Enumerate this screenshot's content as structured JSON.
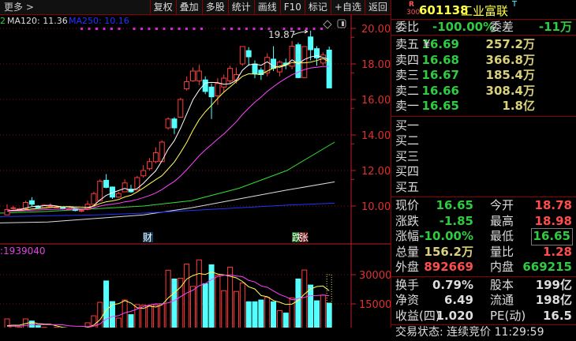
{
  "toolbar": {
    "more": "更多 >",
    "buttons": [
      "复权",
      "叠加",
      "多股",
      "统计",
      "画线",
      "F10",
      "标记",
      "+自选",
      "返回"
    ]
  },
  "chart_header": {
    "fragment": "2",
    "ma120": "MA120: 11.36",
    "ma250": "MA250: 10.16",
    "high_label": "19.87",
    "volume_label": ":1939040",
    "marker_fin": "财",
    "marker_limit_down": "跌",
    "marker_limit_up": "张"
  },
  "colors": {
    "up": "#ff3b3b",
    "down": "#54ffff",
    "ma5": "#ffffff",
    "ma10": "#ffff55",
    "ma20": "#ff44ff",
    "ma60": "#33dd33",
    "ma120": "#dddddd",
    "ma250": "#2233ff",
    "axis": "#c02020"
  },
  "chart_data": [
    {
      "type": "candlestick",
      "ylim": [
        8.6,
        20.5
      ],
      "yticks": [
        "20.00",
        "18.00",
        "16.00",
        "14.00",
        "12.00",
        "10.00"
      ],
      "ytick_values": [
        20,
        18,
        16,
        14,
        12,
        10
      ],
      "ohlc": [
        [
          9.5,
          9.8,
          10.1,
          9.5
        ],
        [
          9.9,
          9.9,
          10.0,
          9.8
        ],
        [
          9.8,
          9.85,
          9.9,
          9.8
        ],
        [
          9.85,
          10.2,
          10.3,
          9.8
        ],
        [
          10.3,
          10.1,
          10.5,
          10.0
        ],
        [
          10.0,
          9.9,
          10.05,
          9.85
        ],
        [
          9.9,
          10.05,
          10.1,
          9.9
        ],
        [
          10.0,
          10.0,
          10.15,
          9.9
        ],
        [
          9.95,
          9.95,
          10.0,
          9.9
        ],
        [
          9.95,
          9.85,
          9.95,
          9.8
        ],
        [
          9.85,
          9.85,
          9.9,
          9.8
        ],
        [
          9.8,
          9.75,
          9.85,
          9.7
        ],
        [
          9.75,
          9.75,
          9.85,
          9.65
        ],
        [
          9.8,
          10.1,
          10.3,
          9.75
        ],
        [
          10.1,
          10.7,
          10.8,
          10.1
        ],
        [
          10.3,
          11.4,
          11.5,
          10.3
        ],
        [
          11.45,
          11.05,
          11.8,
          11.0
        ],
        [
          11.07,
          10.5,
          11.1,
          10.4
        ],
        [
          10.5,
          10.7,
          10.8,
          10.45
        ],
        [
          10.8,
          11.3,
          11.5,
          10.8
        ],
        [
          10.95,
          10.8,
          11.2,
          10.75
        ],
        [
          10.9,
          11.6,
          11.7,
          10.9
        ],
        [
          11.7,
          12.0,
          12.3,
          11.6
        ],
        [
          12.1,
          12.5,
          12.7,
          12.0
        ],
        [
          12.5,
          13.0,
          13.3,
          12.4
        ],
        [
          12.5,
          13.6,
          13.7,
          12.5
        ],
        [
          14.4,
          14.9,
          15.0,
          14.3
        ],
        [
          14.9,
          14.4,
          15.0,
          14.05
        ],
        [
          15.0,
          16.0,
          16.1,
          15.0
        ],
        [
          16.6,
          17.0,
          17.3,
          16.5
        ],
        [
          17.05,
          17.6,
          17.8,
          17.0
        ],
        [
          17.05,
          17.6,
          17.95,
          16.8
        ],
        [
          17.1,
          16.45,
          17.3,
          16.3
        ],
        [
          16.7,
          16.15,
          16.9,
          14.9
        ],
        [
          16.2,
          16.9,
          17.2,
          15.7
        ],
        [
          16.7,
          17.2,
          17.4,
          16.4
        ],
        [
          17.05,
          17.75,
          17.9,
          16.9
        ],
        [
          17.1,
          17.4,
          17.8,
          16.9
        ],
        [
          18.0,
          18.98,
          19.0,
          17.9
        ],
        [
          18.75,
          18.4,
          18.95,
          17.9
        ],
        [
          18.0,
          17.45,
          18.2,
          17.2
        ],
        [
          17.65,
          17.4,
          17.8,
          17.1
        ],
        [
          17.5,
          18.37,
          18.6,
          17.3
        ],
        [
          18.27,
          17.75,
          19.0,
          17.6
        ],
        [
          17.55,
          18.1,
          18.2,
          17.3
        ],
        [
          18.05,
          17.95,
          18.3,
          17.7
        ],
        [
          17.87,
          19.0,
          19.3,
          17.7
        ],
        [
          19.08,
          17.23,
          19.2,
          17.2
        ],
        [
          17.23,
          18.98,
          19.0,
          17.2
        ],
        [
          19.52,
          18.8,
          19.87,
          18.2
        ],
        [
          18.86,
          18.34,
          19.0,
          17.9
        ],
        [
          18.05,
          18.5,
          18.65,
          17.9
        ],
        [
          18.78,
          16.65,
          18.98,
          16.65
        ]
      ],
      "long_ma": [
        {
          "name": "MA60",
          "values": [
            9.6,
            9.7,
            9.85,
            10.0,
            10.3,
            11.0,
            12.0,
            13.6
          ]
        },
        {
          "name": "MA120",
          "values": [
            9.05,
            9.1,
            9.3,
            9.5,
            9.9,
            10.4,
            10.9,
            11.36
          ]
        },
        {
          "name": "MA250",
          "values": [
            9.4,
            9.45,
            9.5,
            9.6,
            9.75,
            9.9,
            10.05,
            10.16
          ]
        }
      ]
    },
    {
      "type": "bar",
      "title": "volume",
      "ylim": [
        0,
        38000
      ],
      "yticks": [
        "30000",
        "15000"
      ],
      "ytick_values": [
        30000,
        15000
      ],
      "values": [
        7300,
        4000,
        3000,
        7300,
        6200,
        3800,
        3000,
        2500,
        3000,
        2500,
        2000,
        2500,
        2000,
        5300,
        8900,
        15800,
        26800,
        16200,
        7700,
        17000,
        9500,
        14600,
        14400,
        14000,
        14400,
        15100,
        32300,
        27800,
        28200,
        35500,
        24000,
        37600,
        25400,
        35100,
        29700,
        21800,
        33900,
        21400,
        25800,
        16100,
        16100,
        17000,
        18400,
        16100,
        11600,
        10300,
        18100,
        27800,
        32400,
        24700,
        16600,
        19500,
        15400
      ]
    }
  ],
  "quote": {
    "badge_top": "R",
    "badge_bottom": "300",
    "code": "601138",
    "name": "工业富联",
    "t_mark": "T",
    "weibi_label": "委比",
    "weibi": "-100.00%",
    "weicha_label": "委差",
    "weicha": "-11万",
    "asks": [
      {
        "label": "卖五",
        "yen": "¥",
        "price": "16.69",
        "vol": "257.2万"
      },
      {
        "label": "卖四",
        "price": "16.68",
        "vol": "366.8万"
      },
      {
        "label": "卖三",
        "price": "16.67",
        "vol": "185.4万"
      },
      {
        "label": "卖二",
        "price": "16.66",
        "vol": "308.4万"
      },
      {
        "label": "卖一",
        "price": "16.65",
        "vol": "1.8亿"
      }
    ],
    "bids": [
      {
        "label": "买一"
      },
      {
        "label": "买二"
      },
      {
        "label": "买三"
      },
      {
        "label": "买四"
      },
      {
        "label": "买五"
      }
    ],
    "stats": [
      {
        "l1": "现价",
        "v1": "16.65",
        "c1": "g",
        "l2": "今开",
        "v2": "18.78",
        "c2": "red"
      },
      {
        "l1": "涨跌",
        "v1": "-1.85",
        "c1": "g",
        "l2": "最高",
        "v2": "18.98",
        "c2": "red"
      },
      {
        "l1": "涨幅",
        "v1": "-10.00%",
        "c1": "g",
        "l2": "最低",
        "v2": "16.65",
        "c2": "g"
      },
      {
        "l1": "总量",
        "v1": "156.2万",
        "c1": "y",
        "l2": "量比",
        "v2": "1.28",
        "c2": "red"
      },
      {
        "l1": "外盘",
        "v1": "892669",
        "c1": "red",
        "l2": "内盘",
        "v2": "669215",
        "c2": "g"
      }
    ],
    "fund": [
      {
        "l1": "换手",
        "v1": "0.79%",
        "l2": "股本",
        "v2": "199亿"
      },
      {
        "l1": "净资",
        "v1": "6.49",
        "l2": "流通",
        "v2": "198亿"
      },
      {
        "l1": "收益(四)",
        "v1": "1.020",
        "l2": "PE(动)",
        "v2": "16.5"
      }
    ],
    "status": "交易状态: 连续竞价 11:29:59"
  }
}
